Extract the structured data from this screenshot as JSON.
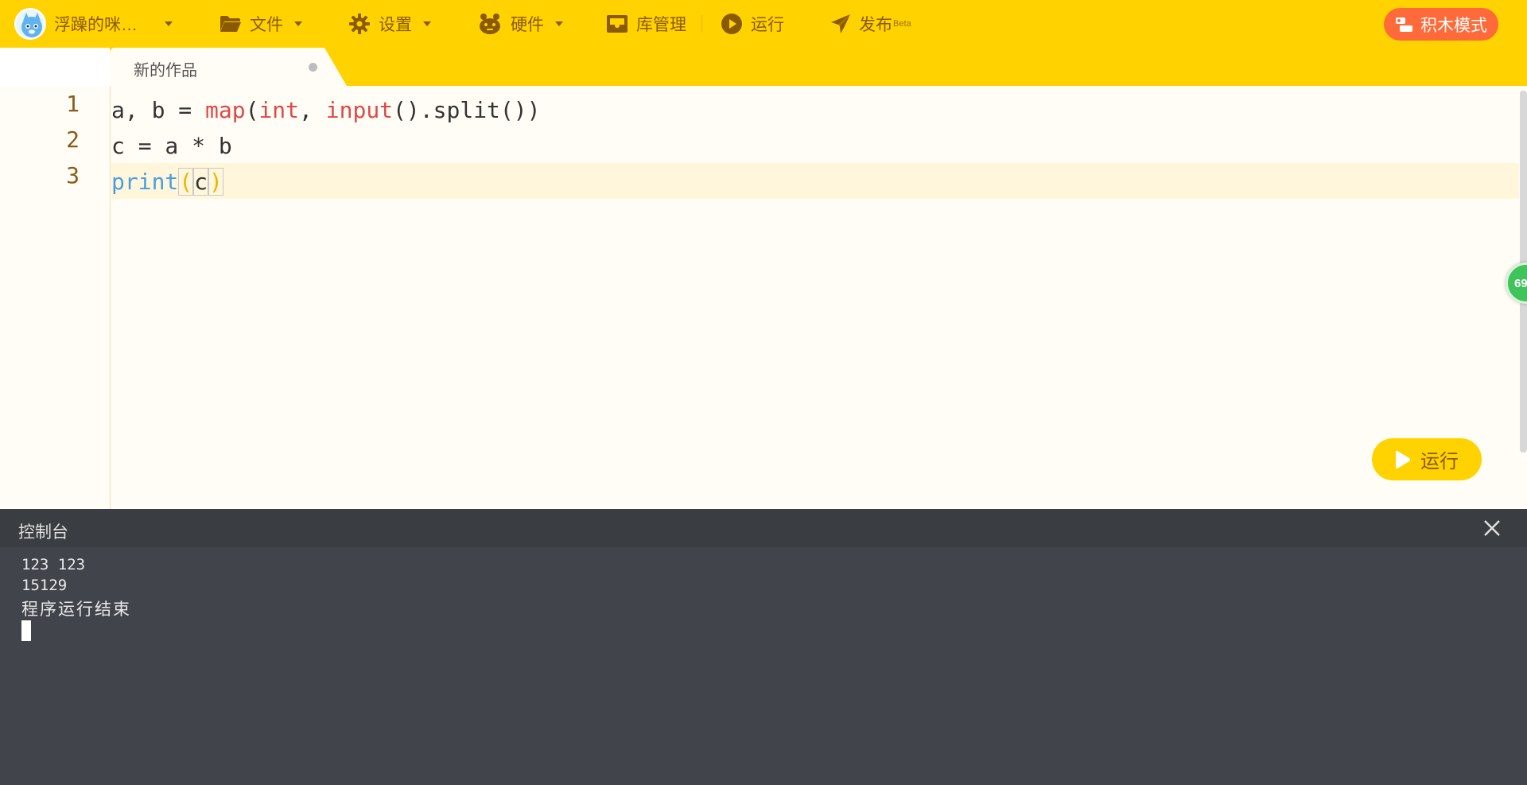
{
  "toolbar": {
    "user_name": "浮躁的咪…",
    "file_label": "文件",
    "settings_label": "设置",
    "hardware_label": "硬件",
    "library_label": "库管理",
    "run_label": "运行",
    "publish_label": "发布",
    "publish_badge": "Beta",
    "block_mode_label": "积木模式"
  },
  "tabs": [
    {
      "label": "新的作品",
      "unsaved": true
    }
  ],
  "editor": {
    "line_numbers": [
      "1",
      "2",
      "3"
    ],
    "lines": [
      "a, b = map(int, input().split())",
      "c = a * b",
      "print(c)"
    ],
    "active_line": 3,
    "floating_badge": "69",
    "run_button_label": "运行"
  },
  "console": {
    "title": "控制台",
    "output": [
      "123 123",
      "15129",
      "程序运行结束"
    ]
  },
  "colors": {
    "toolbar_bg": "#ffd200",
    "accent_orange": "#ff6a3a",
    "keyword_red": "#e04848",
    "keyword_blue": "#4a9ee0",
    "console_bg": "#41444a"
  },
  "icons": [
    "avatar",
    "folder-icon",
    "gear-icon",
    "hardware-icon",
    "library-icon",
    "play-icon",
    "send-icon",
    "block-mode-icon",
    "close-icon"
  ]
}
